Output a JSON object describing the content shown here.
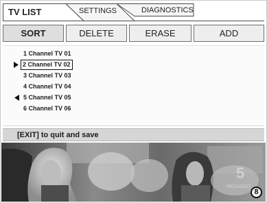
{
  "tabs": [
    {
      "label": "TV LIST",
      "active": true
    },
    {
      "label": "SETTINGS",
      "active": false
    },
    {
      "label": "DIAGNOSTICS",
      "active": false
    }
  ],
  "toolbar": {
    "sort_label": "SORT",
    "delete_label": "DELETE",
    "erase_label": "ERASE",
    "add_label": "ADD"
  },
  "channels": [
    {
      "number": "1",
      "name": "Channel TV 01",
      "marker": "",
      "selected": false
    },
    {
      "number": "2",
      "name": "Channel TV 02",
      "marker": "play-right-icon",
      "selected": true
    },
    {
      "number": "3",
      "name": "Channel TV 03",
      "marker": "",
      "selected": false
    },
    {
      "number": "4",
      "name": "Channel TV 04",
      "marker": "",
      "selected": false
    },
    {
      "number": "5",
      "name": "Channel TV 05",
      "marker": "play-left-icon",
      "selected": false
    },
    {
      "number": "6",
      "name": "Channel TV 06",
      "marker": "",
      "selected": false
    }
  ],
  "footer": {
    "hint": "[EXIT] to quit and save"
  },
  "photo": {
    "channel_logo": "5",
    "watermark": "MEDIASET",
    "channel_number": "8"
  },
  "colors": {
    "toolbar_bg": "#eeeeee",
    "footer_bg": "#d6d6d6",
    "border": "#6e6e6e"
  }
}
